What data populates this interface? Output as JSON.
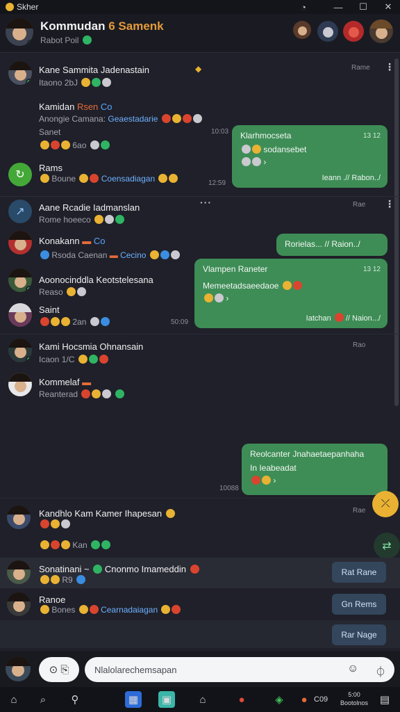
{
  "window": {
    "title": "Skher",
    "minimize": "—",
    "maximize": "☐",
    "close": "✕"
  },
  "header": {
    "title_main": "Kommudan",
    "title_accent": "6 Samenk",
    "subtitle": "Rabot Poil",
    "icons": [
      "avatar-1",
      "avatar-2",
      "avatar-3",
      "avatar-4"
    ]
  },
  "chats": [
    {
      "name": "Kane Sammita Jadenastain",
      "meta": "Itaono 2bJ",
      "timestamp": "Rame"
    },
    {
      "name_a": "Kamidan",
      "name_b": "Rsen",
      "name_c": "Co",
      "meta_a": "Anongie Camana:",
      "meta_b": "Geaestadarie",
      "sub_name": "Sanet",
      "sub_meta": "6ao",
      "timestamp": "10:03"
    },
    {
      "name": "Rams",
      "meta_a": "Boune",
      "meta_b": "Coensadiagan",
      "timestamp": "12:59"
    },
    {
      "name": "Aane Rcadie Iadmanslan",
      "meta": "Rome hoeeco",
      "timestamp": "Rae"
    },
    {
      "name_a": "Konakann",
      "name_b": "Co",
      "meta_a": "Rsoda Caenan",
      "meta_b": "Cecino"
    },
    {
      "name": "Aoonocinddla Keotstelesana",
      "meta": "Reaso"
    },
    {
      "name": "Saint",
      "meta": "2an",
      "timestamp": "50:09"
    },
    {
      "name": "Kami Hocsmia Ohnansain",
      "meta": "Icaon 1/C",
      "timestamp": "Rao"
    },
    {
      "name": "Kommelaf",
      "meta": "Reanterad"
    },
    {
      "name": "Kandhlo Kam Kamer Ihapesan",
      "meta": "Kan",
      "timestamp": "Rae"
    },
    {
      "name_a": "Sonatinani ~",
      "name_b": "Cnonmo Imameddin",
      "meta": "R9",
      "action": "Rat Rane"
    },
    {
      "name": "Ranoe",
      "meta_a": "Bones",
      "meta_b": "Cearnadaiagan",
      "action": "Gn Rems"
    },
    {
      "action": "Rar Nage"
    }
  ],
  "bubbles": [
    {
      "title": "Klarhmocseta",
      "time": "13 12",
      "line2": "sodansebet",
      "footer": "Ieann .// Rabon../"
    },
    {
      "title": "Rorielas...",
      "footer": "// Raion../"
    },
    {
      "title": "Vlampen Raneter",
      "time": "13 12",
      "line2": "Memeetadsaeedaoe",
      "footer": "Iatchan",
      "footer_b": "// Naion.../"
    },
    {
      "title": "Reolcanter Jnahaetaepanhaha",
      "line2": "In Ieabeadat",
      "time": "10088"
    }
  ],
  "composer": {
    "placeholder": "Nlalolarechemsapan"
  },
  "taskbar": {
    "clock_time": "5:00",
    "clock_date": "Bootolnos",
    "tray_text": "C09"
  }
}
